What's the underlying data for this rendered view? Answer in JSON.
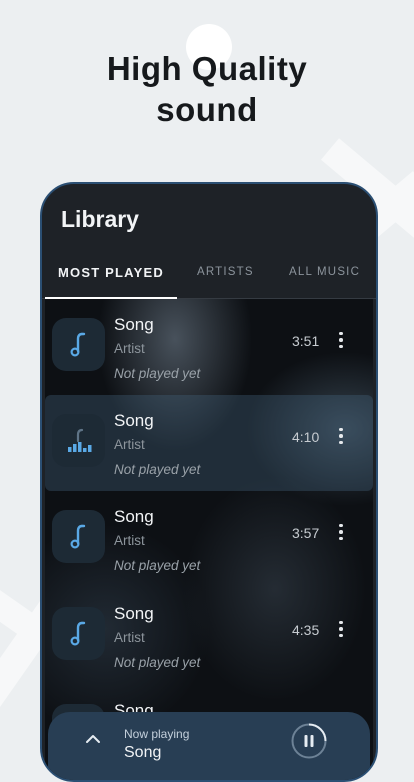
{
  "headline": {
    "line1": "High Quality",
    "line2": "sound"
  },
  "app": {
    "title": "Library",
    "tabs": [
      {
        "label": "MOST PLAYED",
        "active": true
      },
      {
        "label": "ARTISTS",
        "active": false
      },
      {
        "label": "ALL MUSIC",
        "active": false
      }
    ]
  },
  "songs": [
    {
      "title": "Song",
      "artist": "Artist",
      "status": "Not played yet",
      "duration": "3:51",
      "icon": "music-note-icon"
    },
    {
      "title": "Song",
      "artist": "Artist",
      "status": "Not played yet",
      "duration": "4:10",
      "icon": "equalizer-icon",
      "playing": true
    },
    {
      "title": "Song",
      "artist": "Artist",
      "status": "Not played yet",
      "duration": "3:57",
      "icon": "music-note-icon"
    },
    {
      "title": "Song",
      "artist": "Artist",
      "status": "Not played yet",
      "duration": "4:35",
      "icon": "music-note-icon"
    },
    {
      "title": "Song"
    }
  ],
  "player": {
    "label": "Now playing",
    "song": "Song"
  },
  "colors": {
    "accent": "#5aa9e6",
    "background": "#eceff1",
    "phone_frame": "#2b4f73",
    "player_bar": "#283e54"
  }
}
